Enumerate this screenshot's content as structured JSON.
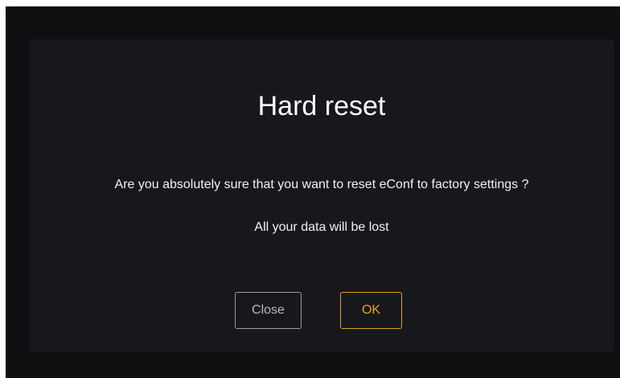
{
  "dialog": {
    "title": "Hard reset",
    "message_line1": "Are you absolutely sure that you want to reset eConf to factory settings ?",
    "message_line2": "All your data will be lost",
    "close_label": "Close",
    "ok_label": "OK"
  },
  "colors": {
    "backdrop": "#0e0f11",
    "dialog_background": "#16181b",
    "ok_accent": "#e0a21c",
    "close_border": "#9a9a9a"
  }
}
